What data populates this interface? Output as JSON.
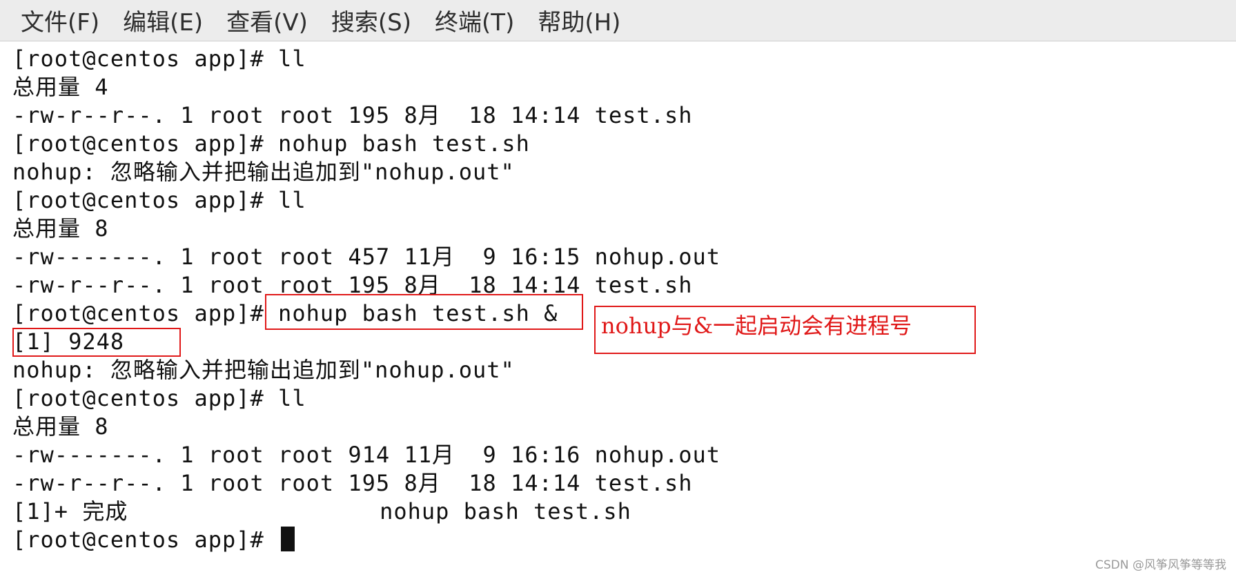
{
  "menubar": {
    "items": [
      {
        "label": "文件(F)"
      },
      {
        "label": "编辑(E)"
      },
      {
        "label": "查看(V)"
      },
      {
        "label": "搜索(S)"
      },
      {
        "label": "终端(T)"
      },
      {
        "label": "帮助(H)"
      }
    ]
  },
  "terminal": {
    "lines": [
      "[root@centos app]# ll",
      "总用量 4",
      "-rw-r--r--. 1 root root 195 8月  18 14:14 test.sh",
      "[root@centos app]# nohup bash test.sh",
      "nohup: 忽略输入并把输出追加到\"nohup.out\"",
      "[root@centos app]# ll",
      "总用量 8",
      "-rw-------. 1 root root 457 11月  9 16:15 nohup.out",
      "-rw-r--r--. 1 root root 195 8月  18 14:14 test.sh",
      "[root@centos app]# nohup bash test.sh &",
      "[1] 9248",
      "nohup: 忽略输入并把输出追加到\"nohup.out\"",
      "[root@centos app]# ll",
      "总用量 8",
      "-rw-------. 1 root root 914 11月  9 16:16 nohup.out",
      "-rw-r--r--. 1 root root 195 8月  18 14:14 test.sh",
      "[1]+ 完成                  nohup bash test.sh",
      "[root@centos app]# "
    ]
  },
  "annotation": {
    "text": "nohup与&一起启动会有进程号",
    "color": "#e01818"
  },
  "watermark": "CSDN @风筝风筝等等我"
}
